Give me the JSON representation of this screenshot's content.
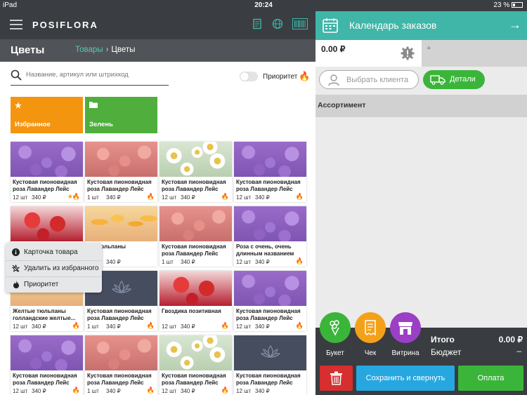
{
  "status_bar": {
    "device": "iPad",
    "time": "20:24",
    "battery": "23 %"
  },
  "app": {
    "logo": "POSIFLORA"
  },
  "section": {
    "title": "Цветы",
    "breadcrumb_parent": "Товары",
    "breadcrumb_current": "Цветы"
  },
  "search": {
    "placeholder": "Название, артикул или штрихкод"
  },
  "priority_toggle": {
    "label": "Приоритет"
  },
  "categories": [
    {
      "label": "Избранное",
      "color": "#f4950f",
      "icon": "star-icon"
    },
    {
      "label": "Зелень",
      "color": "#4fae3c",
      "icon": "folder-icon"
    }
  ],
  "products": [
    {
      "name": "Кустовая пионовидная роза Лавандер Лейс",
      "qty": "12 шт",
      "price": "340 ₽",
      "image": "purple"
    },
    {
      "name": "Кустовая пионовидная роза Лавандер Лейс",
      "qty": "1 шт",
      "price": "340 ₽",
      "image": "pink"
    },
    {
      "name": "Кустовая пионовидная роза Лавандер Лейс",
      "qty": "12 шт",
      "price": "340 ₽",
      "image": "daisy"
    },
    {
      "name": "Кустовая пионовидная роза Лавандер Лейс",
      "qty": "12 шт",
      "price": "340 ₽",
      "image": "purple"
    },
    {
      "name": "",
      "qty": "",
      "price": "",
      "image": "red"
    },
    {
      "name": "ые тюльпаны",
      "qty": "",
      "price": "340 ₽",
      "image": "tulip"
    },
    {
      "name": "Кустовая пионовидная роза Лавандер Лейс",
      "qty": "1 шт",
      "price": "340 ₽",
      "image": "pink"
    },
    {
      "name": "Роза с очень, очень длинным названием",
      "qty": "12 шт",
      "price": "340 ₽",
      "image": "purple"
    },
    {
      "name": "Желтые тюльпаны голландские желтые...",
      "qty": "12 шт",
      "price": "340 ₽",
      "image": "tulip"
    },
    {
      "name": "Кустовая пионовидная роза Лавандер Лейс",
      "qty": "1 шт",
      "price": "340 ₽",
      "image": "placeholder"
    },
    {
      "name": "Гвоздика позитивная",
      "qty": "12 шт",
      "price": "340 ₽",
      "image": "red"
    },
    {
      "name": "Кустовая пионовидная роза Лавандер Лейс",
      "qty": "12 шт",
      "price": "340 ₽",
      "image": "purple"
    },
    {
      "name": "Кустовая пионовидная роза Лавандер Лейс",
      "qty": "12 шт",
      "price": "340 ₽",
      "image": "purple"
    },
    {
      "name": "Кустовая пионовидная роза Лавандер Лейс",
      "qty": "1 шт",
      "price": "340 ₽",
      "image": "pink"
    },
    {
      "name": "Кустовая пионовидная роза Лавандер Лейс",
      "qty": "12 шт",
      "price": "340 ₽",
      "image": "daisy"
    },
    {
      "name": "Кустовая пионовидная роза Лавандер Лейс",
      "qty": "12 шт",
      "price": "340 ₽",
      "image": "placeholder"
    }
  ],
  "context_menu": {
    "items": [
      {
        "label": "Карточка товара",
        "icon": "info-icon"
      },
      {
        "label": "Удалить из избранного",
        "icon": "unstar-icon"
      },
      {
        "label": "Приоритет",
        "icon": "flame-icon"
      }
    ]
  },
  "order_panel": {
    "title": "Календарь заказов",
    "order_amount": "0.00 ₽",
    "add_tab": "+",
    "client_button": "Выбрать клиента",
    "details_button": "Детали",
    "assortment_label": "Ассортимент",
    "actions": [
      {
        "label": "Букет",
        "color": "#3ab53a",
        "icon": "bouquet-icon"
      },
      {
        "label": "Чек",
        "color": "#f4a11a",
        "icon": "receipt-icon"
      },
      {
        "label": "Витрина",
        "color": "#9b3fc7",
        "icon": "storefront-icon"
      }
    ],
    "total_label": "Итого",
    "total_value": "0.00 ₽",
    "budget_label": "Бюджет",
    "budget_value": "–",
    "save_button": "Сохранить и свернуть",
    "pay_button": "Оплата"
  },
  "colors": {
    "accent": "#3fb6a8",
    "dark_bar": "#3a3e42",
    "green": "#3ab53a",
    "blue": "#27a7e0",
    "red": "#d62f2f"
  }
}
